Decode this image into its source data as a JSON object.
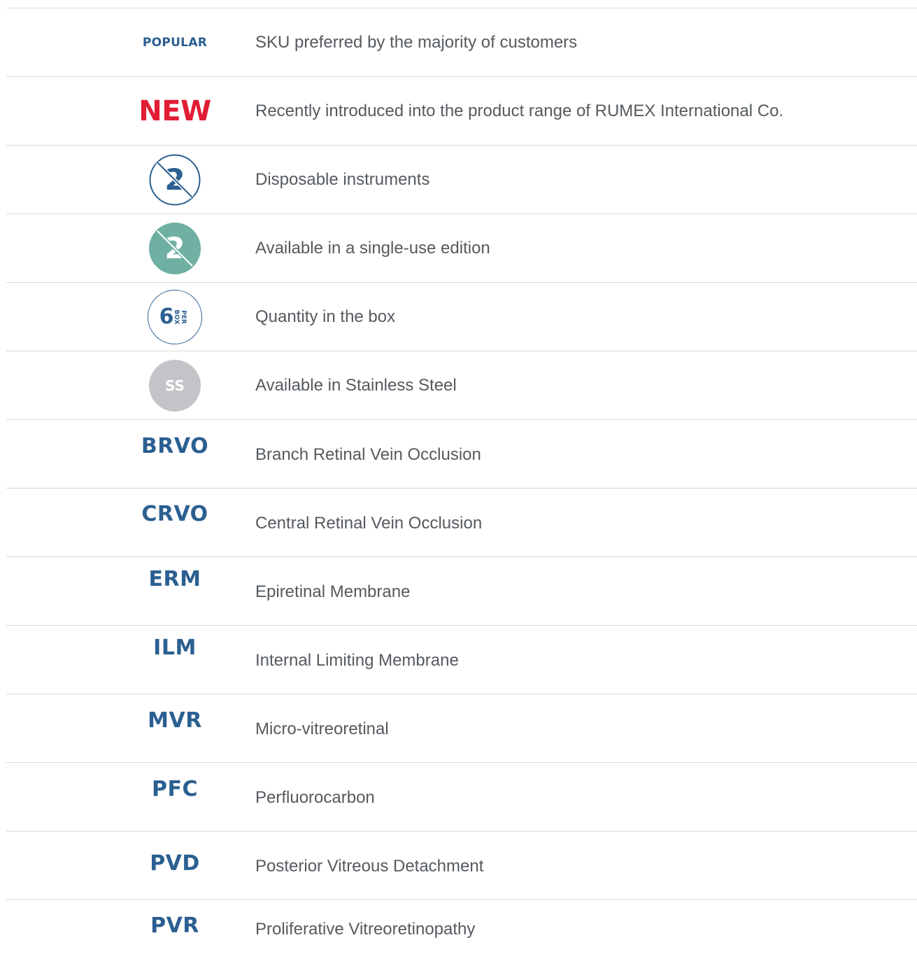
{
  "legend": {
    "rows": [
      {
        "key": "popular",
        "tag": "POPULAR",
        "description": "SKU preferred by the majority of customers"
      },
      {
        "key": "new",
        "tag": "NEW",
        "description": "Recently introduced into the product range of RUMEX International Co."
      },
      {
        "key": "disposable",
        "icon": "disposable-2-outline-icon",
        "glyph": "2",
        "description": "Disposable instruments"
      },
      {
        "key": "single-use",
        "icon": "single-use-2-filled-icon",
        "glyph": "2",
        "description": "Available in a single-use edition"
      },
      {
        "key": "per-box",
        "icon": "per-box-icon",
        "quantity": "6",
        "unit": "PER BOX",
        "description": "Quantity in the box"
      },
      {
        "key": "stainless",
        "icon": "stainless-steel-icon",
        "glyph": "SS",
        "description": "Available in Stainless Steel"
      },
      {
        "key": "brvo",
        "tag": "BRVO",
        "description": "Branch Retinal Vein Occlusion"
      },
      {
        "key": "crvo",
        "tag": "CRVO",
        "description": "Central Retinal Vein Occlusion"
      },
      {
        "key": "erm",
        "tag": "ERM",
        "description": "Epiretinal Membrane"
      },
      {
        "key": "ilm",
        "tag": "ILM",
        "description": "Internal Limiting Membrane"
      },
      {
        "key": "mvr",
        "tag": "MVR",
        "description": "Micro-vitreoretinal"
      },
      {
        "key": "pfc",
        "tag": "PFC",
        "description": "Perfluorocarbon"
      },
      {
        "key": "pvd",
        "tag": "PVD",
        "description": "Posterior Vitreous Detachment"
      },
      {
        "key": "pvr",
        "tag": "PVR",
        "description": "Proliferative Vitreoretinopathy"
      }
    ]
  },
  "colors": {
    "brand_blue": "#2b5f91",
    "new_red": "#e11d34",
    "teal": "#6fb0a3",
    "steel_gray": "#c3c4c7",
    "text": "#555a5f",
    "divider": "#d9d9d9"
  }
}
